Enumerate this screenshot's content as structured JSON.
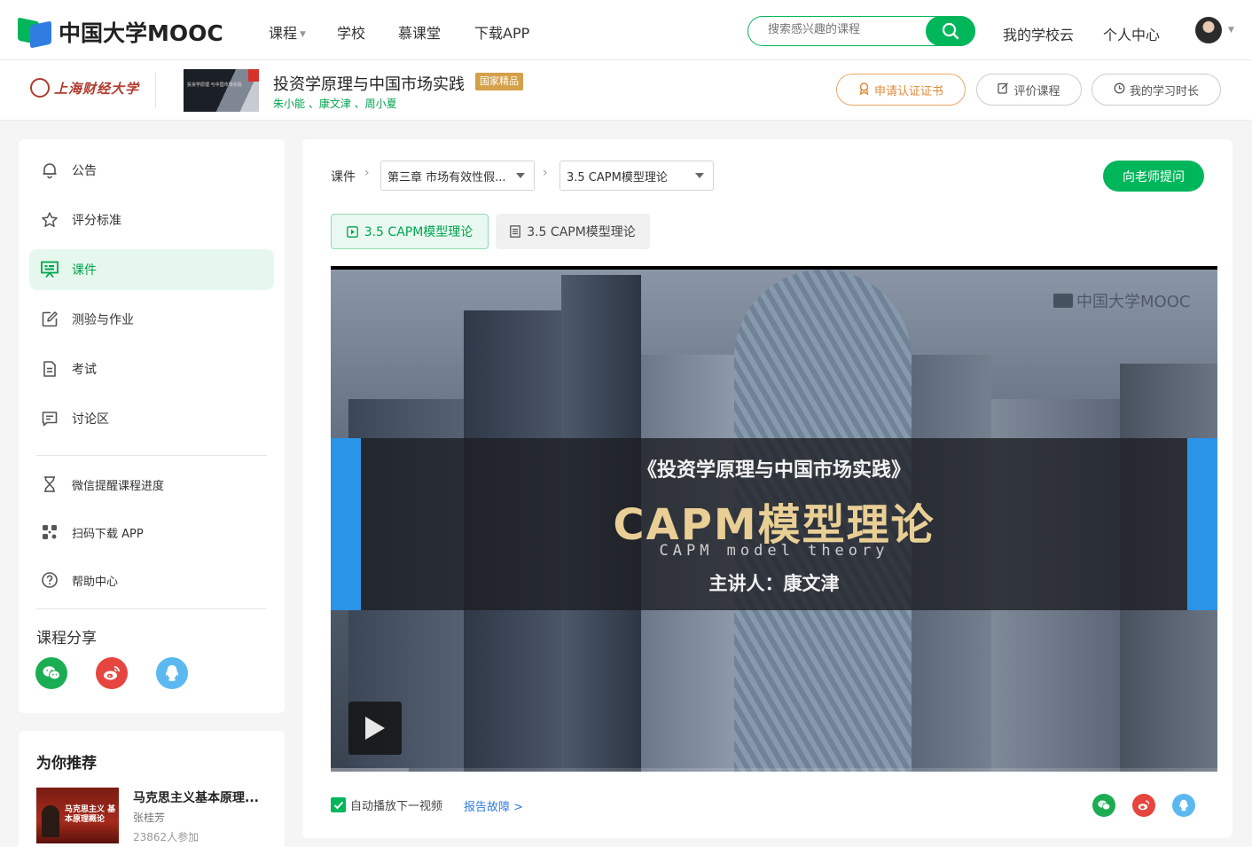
{
  "brand": {
    "name": "中国大学MOOC"
  },
  "nav": {
    "items": [
      {
        "label": "课程",
        "has_dropdown": true
      },
      {
        "label": "学校",
        "has_dropdown": false
      },
      {
        "label": "慕课堂",
        "has_dropdown": false
      },
      {
        "label": "下载APP",
        "has_dropdown": false
      }
    ],
    "search_placeholder": "搜索感兴趣的课程",
    "my_school_cloud": "我的学校云",
    "personal_center": "个人中心"
  },
  "course": {
    "school_name": "上海财经大学",
    "title": "投资学原理与中国市场实践",
    "badge": "国家精品",
    "teachers": "朱小能 、康文津 、周小夏",
    "thumb_text": "投资学原理 与中国市场实践",
    "buttons": {
      "certificate": "申请认证证书",
      "rate": "评价课程",
      "study_time": "我的学习时长"
    }
  },
  "sidebar": {
    "items": [
      {
        "label": "公告",
        "icon": "bell-icon",
        "active": false
      },
      {
        "label": "评分标准",
        "icon": "star-icon",
        "active": false
      },
      {
        "label": "课件",
        "icon": "presentation-icon",
        "active": true
      },
      {
        "label": "测验与作业",
        "icon": "edit-icon",
        "active": false
      },
      {
        "label": "考试",
        "icon": "document-icon",
        "active": false
      },
      {
        "label": "讨论区",
        "icon": "chat-icon",
        "active": false
      }
    ],
    "tools": [
      {
        "label": "微信提醒课程进度",
        "icon": "hourglass-icon"
      },
      {
        "label": "扫码下载 APP",
        "icon": "qrcode-icon"
      },
      {
        "label": "帮助中心",
        "icon": "help-icon"
      }
    ],
    "share_title": "课程分享",
    "share_icons": [
      "wechat-icon",
      "weibo-icon",
      "qq-icon"
    ]
  },
  "recommend": {
    "title": "为你推荐",
    "item": {
      "name": "马克思主义基本原理...",
      "teacher": "张桂芳",
      "count": "23862人参加",
      "thumb_text": "马克思主义 基本原理概论"
    }
  },
  "main": {
    "crumb_label": "课件",
    "chapter_select": "第三章 市场有效性假...",
    "lesson_select": "3.5 CAPM模型理论",
    "ask_button": "向老师提问",
    "unit_tabs": [
      {
        "label": "3.5  CAPM模型理论",
        "type": "video",
        "active": true
      },
      {
        "label": "3.5 CAPM模型理论",
        "type": "document",
        "active": false
      }
    ],
    "video": {
      "watermark": "中国大学MOOC",
      "subtitle": "《投资学原理与中国市场实践》",
      "title": "CAPM模型理论",
      "title_en": "CAPM model theory",
      "speaker": "主讲人：康文津",
      "progress": 0.088
    },
    "autoplay_label": "自动播放下一视频",
    "autoplay_checked": true,
    "report_label": "报告故障 >"
  },
  "colors": {
    "brand_green": "#00b65b",
    "brand_blue": "#2f7de1",
    "badge_gold": "#d4a04a",
    "cert_orange": "#e08a38",
    "wechat": "#1aad52",
    "weibo": "#e6463f",
    "qq": "#5cb8f0"
  }
}
